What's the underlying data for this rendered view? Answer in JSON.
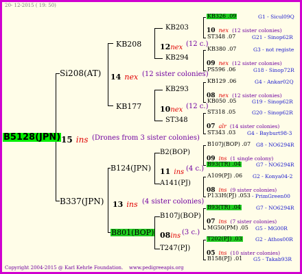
{
  "header": {
    "date": "20- 12-2015 ( 19: 50)"
  },
  "root": {
    "label": "B5128(JPN)",
    "gen_num": "15",
    "gen_ins": "ins",
    "note": "(Drones from 3 sister colonies)"
  },
  "gen1": [
    {
      "label": "Si208(AT)",
      "num": "14",
      "ins": "nex",
      "note": "(12 sister colonies)"
    },
    {
      "label": "B337(JPN)",
      "num": "13",
      "ins": "ins",
      "note": "(4 sister colonies)"
    }
  ],
  "gen2": [
    {
      "label": "KB208",
      "num": "12",
      "ins": "nex",
      "note": "(12 c.)"
    },
    {
      "label": "KB177",
      "num": "10",
      "ins": "nex",
      "note": "(12 c.)"
    },
    {
      "label": "B124(JPN)",
      "num": "11",
      "ins": "ins",
      "note": "(4 c.)"
    },
    {
      "label": "B801(BOP)",
      "num": "08",
      "ins": "ins",
      "note": "(3 c.)"
    }
  ],
  "gen3": [
    "KB203",
    "KB294",
    "KB293",
    "ST348",
    "B2(BOP)",
    "A141(PJ)",
    "B107j(BOP)",
    "T247(PJ)"
  ],
  "gen4": [
    {
      "top": "KB326 .09",
      "top_id": "G1 - Sicul09Q",
      "num": "10",
      "ins": "nex",
      "note": "(12 sister colonies)",
      "bottom": "ST348 .07",
      "bottom_id": "G21 - Sinop62R"
    },
    {
      "top": "KB380 .07",
      "top_id": "G3 - not registe",
      "num": "09",
      "ins": "nex",
      "note": "(12 sister colonies)",
      "bottom": "PS596 .06",
      "bottom_id": "G18 - Sinop72R"
    },
    {
      "top": "KB129 .06",
      "top_id": "G4 - Ankar02Q",
      "num": "08",
      "ins": "nex",
      "note": "(12 sister colonies)",
      "bottom": "KB050 .05",
      "bottom_id": "G19 - Sinop62R"
    },
    {
      "top": "ST318 .05",
      "top_id": "G20 - Sinop62R",
      "num": "07",
      "ins": "alr",
      "note": "(14 sister colonies)",
      "bottom": "ST343 .03",
      "bottom_id": "G4 - Bayburt98-3"
    },
    {
      "top": "B107j(BOP) .07",
      "top_id": "G8 - NO6294R",
      "num": "09",
      "ins": "ins",
      "note": "(1 single colony)",
      "bottom": "B93(TR) .04",
      "bottom_id": "G7 - NO6294R"
    },
    {
      "top": "A109(PJ) .06",
      "top_id": "G2 - Konya04-2",
      "num": "08",
      "ins": "ins",
      "note": "(9 sister colonies)",
      "bottom": "P133H(PJ) .053",
      "bottom_id": "- PrimGreen00"
    },
    {
      "top": "B93(TR) .04",
      "top_id": "G7 - NO6294R",
      "num": "07",
      "ins": "ins",
      "note": "(7 sister colonies)",
      "bottom": "MG50(PM) .05",
      "bottom_id": "G5 - MG00R"
    },
    {
      "top": "T202(PJ) .03",
      "top_id": "G2 - Athos00R",
      "num": "05",
      "ins": "ins",
      "note": "(10 sister colonies)",
      "bottom": "B158(PJ) .01",
      "bottom_id": "G5 - Takab93R"
    }
  ],
  "footer": {
    "copyright": "Copyright 2004-2015 @ Karl Kehrle Foundation.",
    "site": "www.pedigreeapis.org"
  },
  "colors": {
    "border": "#d000d0",
    "background": "#fffde8",
    "highlight": "#20cc20",
    "root_highlight": "#00ee00",
    "ins": "#e00000",
    "note": "#7000a0",
    "id": "#1a1acd"
  }
}
